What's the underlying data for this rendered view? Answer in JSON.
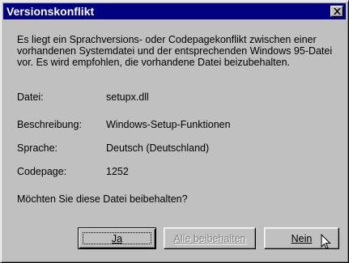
{
  "window": {
    "title": "Versionskonflikt"
  },
  "message": "Es liegt ein Sprachversions- oder Codepagekonflikt zwischen einer vorhandenen Systemdatei und der entsprechenden Windows 95-Datei vor. Es wird empfohlen, die vorhandene Datei beizubehalten.",
  "details": [
    {
      "label": "Datei:",
      "value": "setupx.dll"
    },
    {
      "label": "Beschreibung:",
      "value": "Windows-Setup-Funktionen"
    },
    {
      "label": "Sprache:",
      "value": "Deutsch (Deutschland)"
    },
    {
      "label": "Codepage:",
      "value": "1252"
    }
  ],
  "question": "Möchten Sie diese Datei beibehalten?",
  "buttons": {
    "yes": "Ja",
    "keep_all": "Alle beibehalten",
    "no": "Nein"
  },
  "icons": {
    "close": "close-icon",
    "cursor": "arrow-cursor-icon"
  },
  "colors": {
    "titlebar": "#000080",
    "face": "#c0c0c0"
  }
}
